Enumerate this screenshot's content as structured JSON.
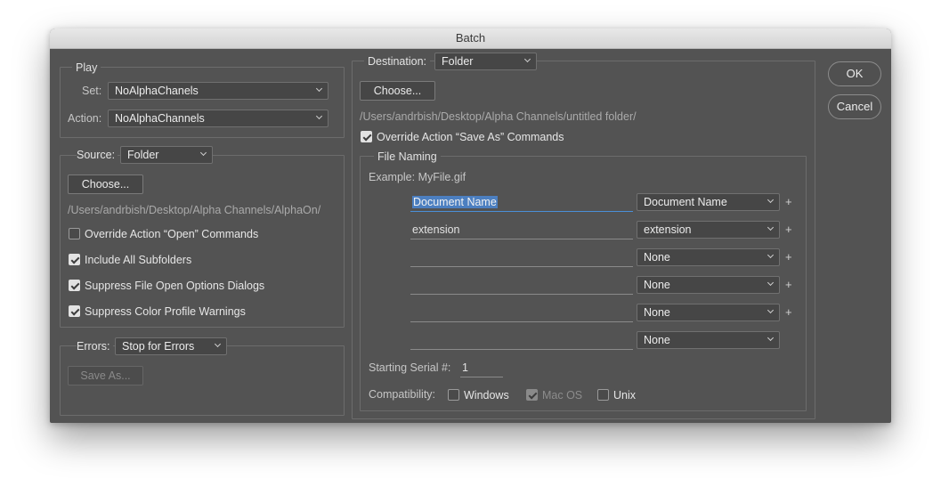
{
  "window": {
    "title": "Batch"
  },
  "play": {
    "legend": "Play",
    "set_label": "Set:",
    "set_value": "NoAlphaChanels",
    "action_label": "Action:",
    "action_value": "NoAlphaChannels"
  },
  "source": {
    "label": "Source:",
    "value": "Folder",
    "choose_label": "Choose...",
    "path": "/Users/andrbish/Desktop/Alpha Channels/AlphaOn/",
    "options": [
      {
        "label": "Override Action “Open” Commands",
        "checked": false
      },
      {
        "label": "Include All Subfolders",
        "checked": true
      },
      {
        "label": "Suppress File Open Options Dialogs",
        "checked": true
      },
      {
        "label": "Suppress Color Profile Warnings",
        "checked": true
      }
    ]
  },
  "errors": {
    "label": "Errors:",
    "value": "Stop for Errors",
    "save_as_label": "Save As..."
  },
  "destination": {
    "label": "Destination:",
    "value": "Folder",
    "choose_label": "Choose...",
    "path": "/Users/andrbish/Desktop/Alpha Channels/untitled folder/",
    "override_save_label": "Override Action “Save As” Commands",
    "override_save_checked": true
  },
  "file_naming": {
    "legend": "File Naming",
    "example": "Example: MyFile.gif",
    "rows": [
      {
        "text": "Document Name",
        "select": "Document Name"
      },
      {
        "text": "extension",
        "select": "extension"
      },
      {
        "text": "",
        "select": "None"
      },
      {
        "text": "",
        "select": "None"
      },
      {
        "text": "",
        "select": "None"
      },
      {
        "text": "",
        "select": "None"
      }
    ],
    "plus_symbol": "+",
    "serial_label": "Starting Serial #:",
    "serial_value": "1",
    "compat_label": "Compatibility:",
    "compat": [
      {
        "label": "Windows",
        "checked": false,
        "disabled": false
      },
      {
        "label": "Mac OS",
        "checked": true,
        "disabled": true
      },
      {
        "label": "Unix",
        "checked": false,
        "disabled": false
      }
    ]
  },
  "buttons": {
    "ok": "OK",
    "cancel": "Cancel"
  }
}
